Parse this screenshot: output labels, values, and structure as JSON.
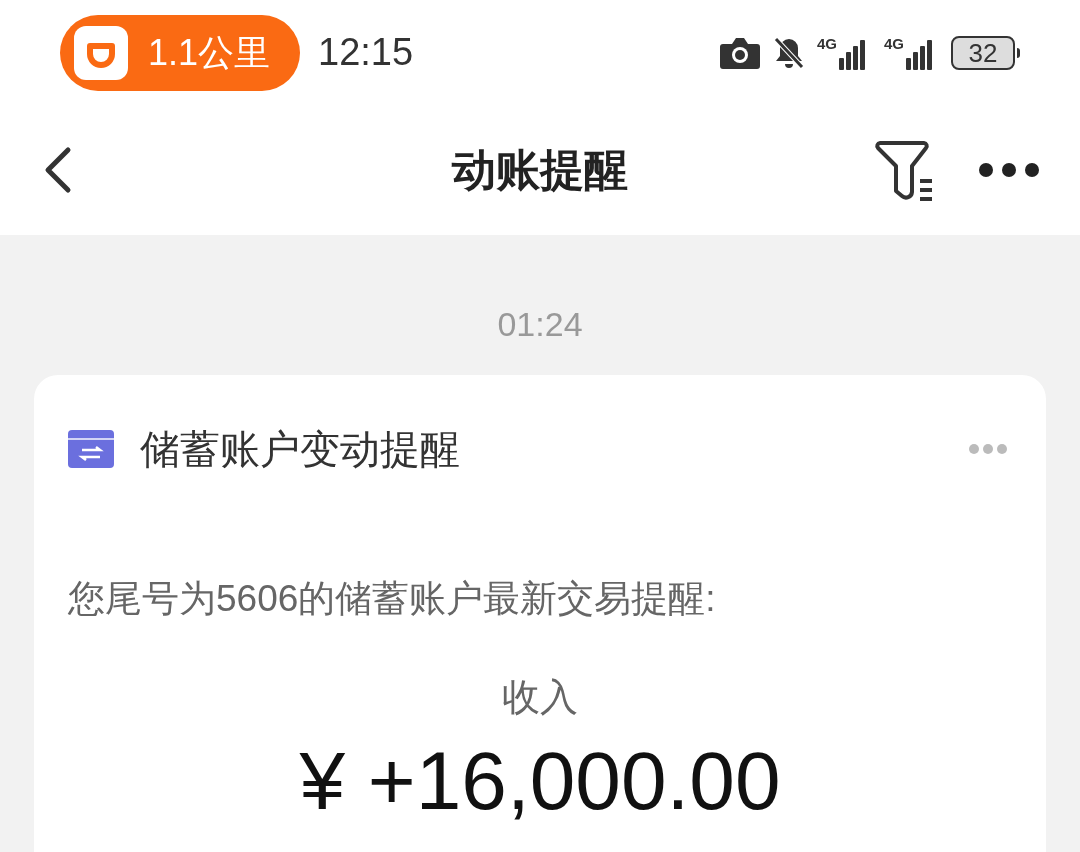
{
  "status_bar": {
    "app_pill": "1.1公里",
    "time": "12:15",
    "network_labels": [
      "4G",
      "4G"
    ],
    "battery": "32"
  },
  "header": {
    "title": "动账提醒"
  },
  "messages": [
    {
      "time": "01:24",
      "card": {
        "title": "储蓄账户变动提醒",
        "body": "您尾号为5606的储蓄账户最新交易提醒:",
        "type_label": "收入",
        "amount": "¥ +16,000.00"
      }
    }
  ]
}
